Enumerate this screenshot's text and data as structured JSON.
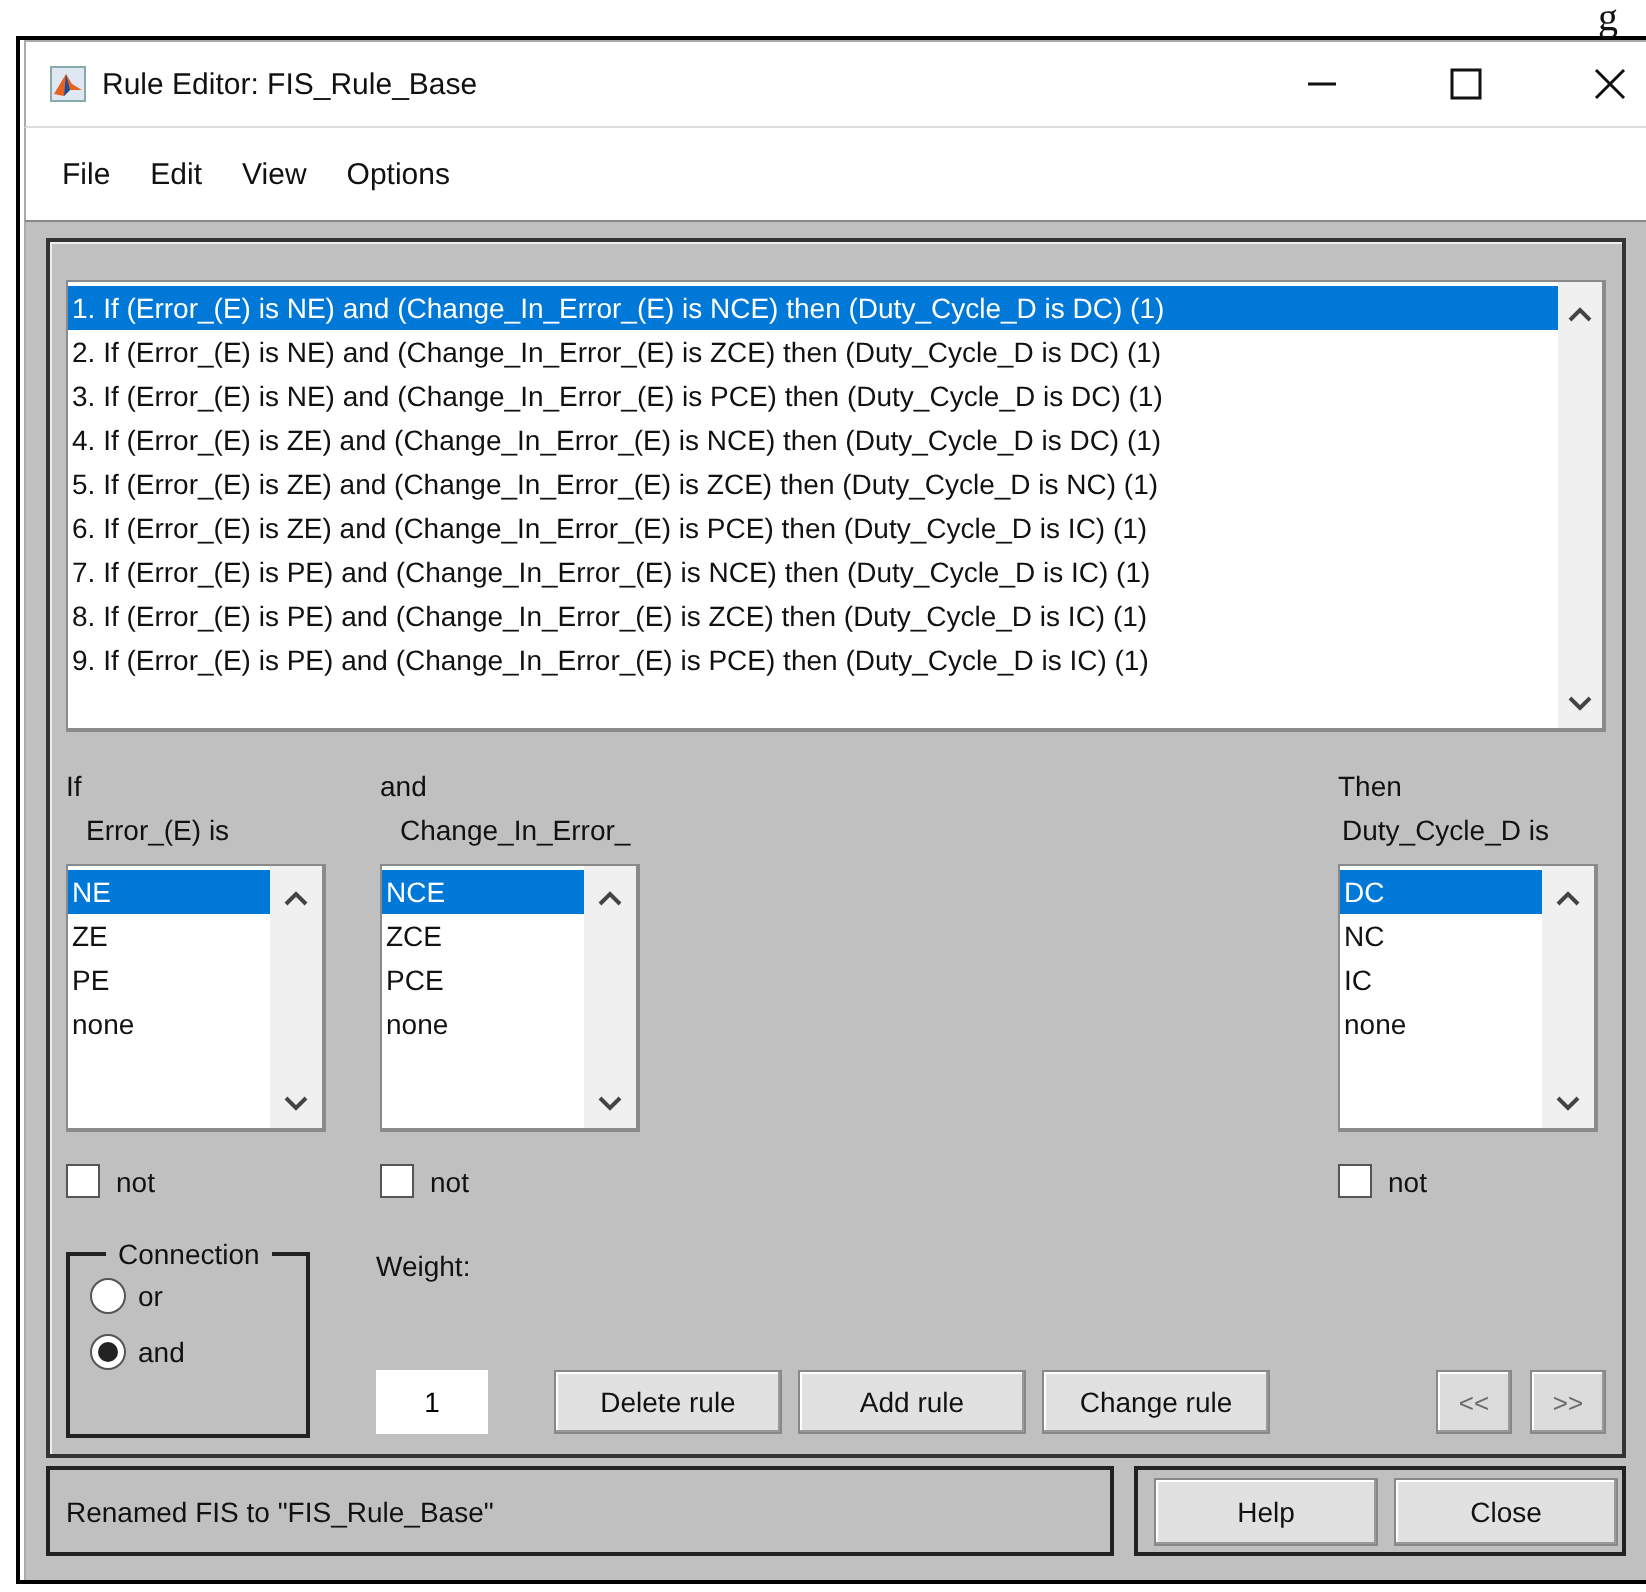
{
  "page_fragment": "g",
  "window": {
    "title": "Rule Editor: FIS_Rule_Base"
  },
  "menu": [
    "File",
    "Edit",
    "View",
    "Options"
  ],
  "rules": [
    {
      "text": "1. If (Error_(E) is NE) and (Change_In_Error_(E) is NCE) then (Duty_Cycle_D is DC) (1)",
      "selected": true
    },
    {
      "text": "2. If (Error_(E) is NE) and (Change_In_Error_(E) is ZCE) then (Duty_Cycle_D is DC) (1)",
      "selected": false
    },
    {
      "text": "3. If (Error_(E) is NE) and (Change_In_Error_(E) is PCE) then (Duty_Cycle_D is DC) (1)",
      "selected": false
    },
    {
      "text": "4. If (Error_(E) is ZE) and (Change_In_Error_(E) is NCE) then (Duty_Cycle_D is DC) (1)",
      "selected": false
    },
    {
      "text": "5. If (Error_(E) is ZE) and (Change_In_Error_(E) is ZCE) then (Duty_Cycle_D is NC) (1)",
      "selected": false
    },
    {
      "text": "6. If (Error_(E) is ZE) and (Change_In_Error_(E) is PCE) then (Duty_Cycle_D is IC) (1)",
      "selected": false
    },
    {
      "text": "7. If (Error_(E) is PE) and (Change_In_Error_(E) is NCE) then (Duty_Cycle_D is IC) (1)",
      "selected": false
    },
    {
      "text": "8. If (Error_(E) is PE) and (Change_In_Error_(E) is ZCE) then (Duty_Cycle_D is IC) (1)",
      "selected": false
    },
    {
      "text": "9. If (Error_(E) is PE) and (Change_In_Error_(E) is PCE) then (Duty_Cycle_D is IC) (1)",
      "selected": false
    }
  ],
  "antecedents": [
    {
      "label": "If",
      "variable": "Error_(E) is",
      "items": [
        {
          "label": "NE",
          "selected": true
        },
        {
          "label": "ZE",
          "selected": false
        },
        {
          "label": "PE",
          "selected": false
        },
        {
          "label": "none",
          "selected": false
        }
      ],
      "not_label": "not",
      "not_checked": false
    },
    {
      "label": "and",
      "variable": "Change_In_Error_",
      "items": [
        {
          "label": "NCE",
          "selected": true
        },
        {
          "label": "ZCE",
          "selected": false
        },
        {
          "label": "PCE",
          "selected": false
        },
        {
          "label": "none",
          "selected": false
        }
      ],
      "not_label": "not",
      "not_checked": false
    }
  ],
  "consequent": {
    "label": "Then",
    "variable": "Duty_Cycle_D is",
    "items": [
      {
        "label": "DC",
        "selected": true
      },
      {
        "label": "NC",
        "selected": false
      },
      {
        "label": "IC",
        "selected": false
      },
      {
        "label": "none",
        "selected": false
      }
    ],
    "not_label": "not",
    "not_checked": false
  },
  "connection": {
    "title": "Connection",
    "options": [
      {
        "label": "or",
        "selected": false
      },
      {
        "label": "and",
        "selected": true
      }
    ]
  },
  "weight": {
    "label": "Weight:",
    "value": "1"
  },
  "buttons": [
    "Delete rule",
    "Add rule",
    "Change rule"
  ],
  "nav_buttons": [
    {
      "label": "<<",
      "disabled": true
    },
    {
      "label": ">>",
      "disabled": true
    }
  ],
  "status": "Renamed FIS to \"FIS_Rule_Base\"",
  "footer_buttons": [
    "Help",
    "Close"
  ]
}
